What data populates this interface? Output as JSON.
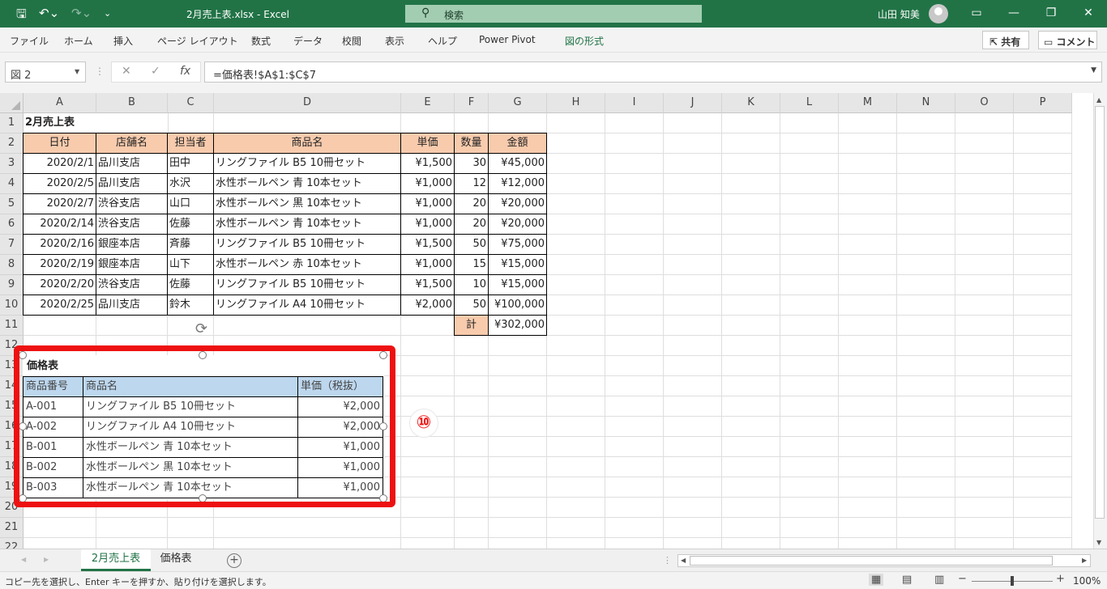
{
  "titlebar": {
    "save_icon": "save-icon",
    "undo_icon": "undo-icon",
    "redo_icon": "redo-icon",
    "customize_icon": "customize-icon",
    "title": "2月売上表.xlsx  -  Excel",
    "search_placeholder": "検索",
    "user": "山田 知美"
  },
  "ribbon": {
    "tabs": [
      "ファイル",
      "ホーム",
      "挿入",
      "ページ レイアウト",
      "数式",
      "データ",
      "校閲",
      "表示",
      "ヘルプ",
      "Power Pivot",
      "図の形式"
    ],
    "share": "共有",
    "comment": "コメント"
  },
  "formula_bar": {
    "name_box": "図 2",
    "formula": "=価格表!$A$1:$C$7"
  },
  "columns": [
    "A",
    "B",
    "C",
    "D",
    "E",
    "F",
    "G",
    "H",
    "I",
    "J",
    "K",
    "L",
    "M",
    "N",
    "O",
    "P"
  ],
  "rows": [
    "1",
    "2",
    "3",
    "4",
    "5",
    "6",
    "7",
    "8",
    "9",
    "10",
    "11",
    "12",
    "13",
    "14",
    "15",
    "16",
    "17",
    "18",
    "19",
    "20",
    "21",
    "22"
  ],
  "sales": {
    "title": "2月売上表",
    "headers": [
      "日付",
      "店舗名",
      "担当者",
      "商品名",
      "単価",
      "数量",
      "金額"
    ],
    "data": [
      [
        "2020/2/1",
        "品川支店",
        "田中",
        "リングファイル B5 10冊セット",
        "¥1,500",
        "30",
        "¥45,000"
      ],
      [
        "2020/2/5",
        "品川支店",
        "水沢",
        "水性ボールペン 青 10本セット",
        "¥1,000",
        "12",
        "¥12,000"
      ],
      [
        "2020/2/7",
        "渋谷支店",
        "山口",
        "水性ボールペン 黒 10本セット",
        "¥1,000",
        "20",
        "¥20,000"
      ],
      [
        "2020/2/14",
        "渋谷支店",
        "佐藤",
        "水性ボールペン 青 10本セット",
        "¥1,000",
        "20",
        "¥20,000"
      ],
      [
        "2020/2/16",
        "銀座本店",
        "斉藤",
        "リングファイル B5 10冊セット",
        "¥1,500",
        "50",
        "¥75,000"
      ],
      [
        "2020/2/19",
        "銀座本店",
        "山下",
        "水性ボールペン 赤 10本セット",
        "¥1,000",
        "15",
        "¥15,000"
      ],
      [
        "2020/2/20",
        "渋谷支店",
        "佐藤",
        "リングファイル B5 10冊セット",
        "¥1,500",
        "10",
        "¥15,000"
      ],
      [
        "2020/2/25",
        "品川支店",
        "鈴木",
        "リングファイル A4 10冊セット",
        "¥2,000",
        "50",
        "¥100,000"
      ]
    ],
    "total_label": "計",
    "total_value": "¥302,000"
  },
  "price_picture": {
    "title": "価格表",
    "headers": [
      "商品番号",
      "商品名",
      "単価（税抜）"
    ],
    "data": [
      [
        "A-001",
        "リングファイル B5 10冊セット",
        "¥2,000"
      ],
      [
        "A-002",
        "リングファイル A4 10冊セット",
        "¥2,000"
      ],
      [
        "B-001",
        "水性ボールペン 青 10本セット",
        "¥1,000"
      ],
      [
        "B-002",
        "水性ボールペン 黒 10本セット",
        "¥1,000"
      ],
      [
        "B-003",
        "水性ボールペン 青 10本セット",
        "¥1,000"
      ]
    ]
  },
  "annotation": "⑩",
  "sheet_tabs": [
    "2月売上表",
    "価格表"
  ],
  "status": {
    "message": "コピー先を選択し、Enter キーを押すか、貼り付けを選択します。",
    "zoom": "100%"
  },
  "colors": {
    "excel_green": "#217346",
    "header_fill": "#f8cbad",
    "picture_header_fill": "#bdd7ee",
    "highlight": "#ee1111"
  }
}
